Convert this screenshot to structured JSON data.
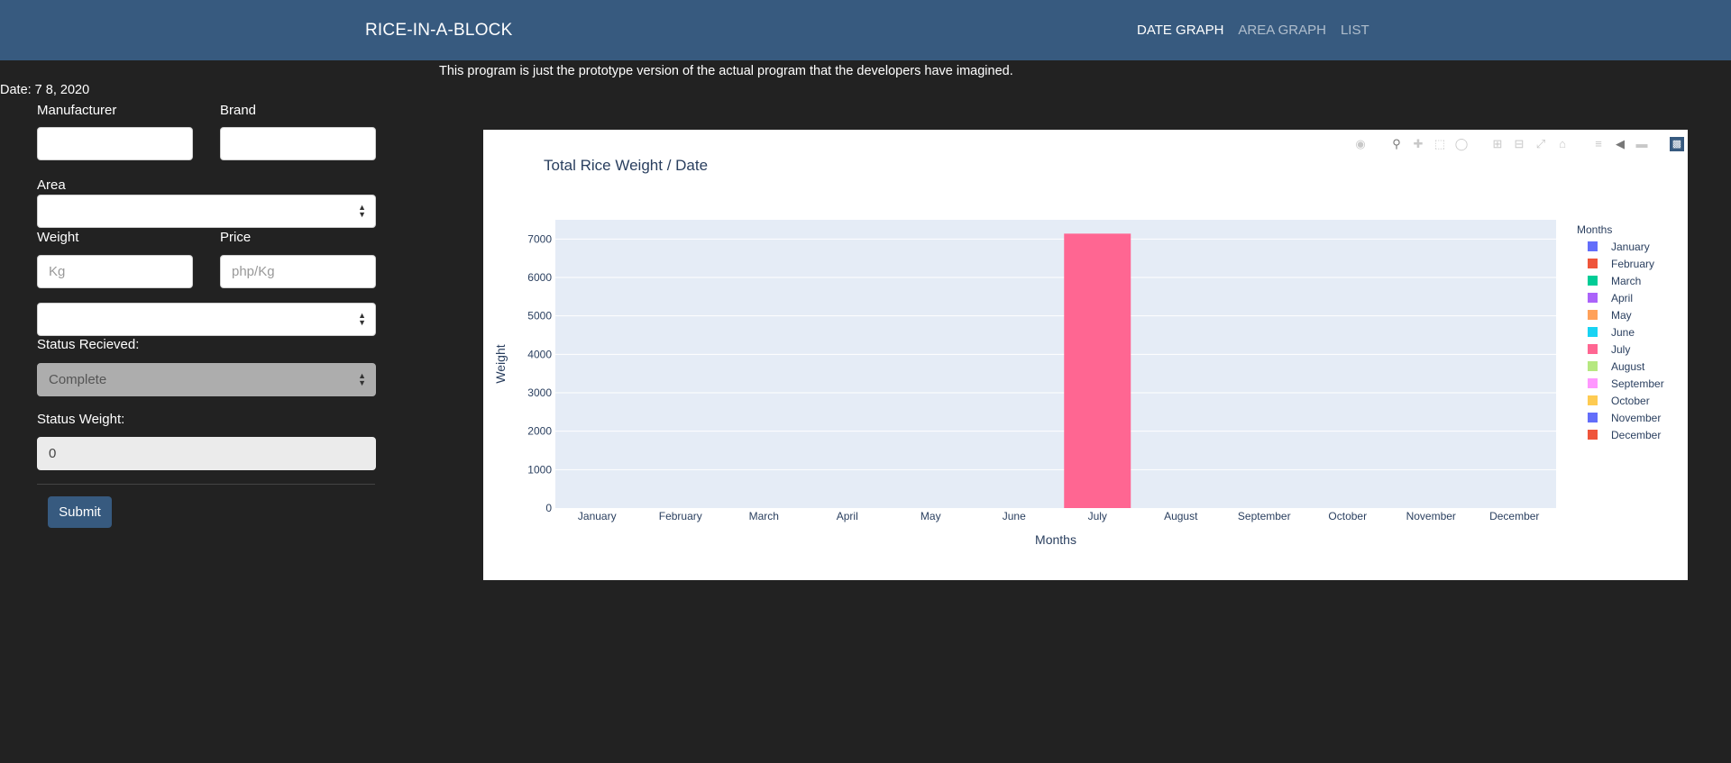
{
  "navbar": {
    "brand": "RICE-IN-A-BLOCK",
    "links": [
      {
        "label": "DATE GRAPH",
        "active": true
      },
      {
        "label": "AREA GRAPH",
        "active": false
      },
      {
        "label": "LIST",
        "active": false
      }
    ]
  },
  "notice": "This program is just the prototype version of the actual program that the developers have imagined.",
  "date_line": "Date: 7 8, 2020",
  "form": {
    "manufacturer_label": "Manufacturer",
    "manufacturer_value": "",
    "brand_label": "Brand",
    "brand_value": "",
    "area_label": "Area",
    "area_value": "",
    "weight_label": "Weight",
    "weight_placeholder": "Kg",
    "price_label": "Price",
    "price_placeholder": "php/Kg",
    "unlabeled_select_value": "",
    "status_received_label": "Status Recieved:",
    "status_received_value": "Complete",
    "status_weight_label": "Status Weight:",
    "status_weight_value": "0",
    "submit_label": "Submit"
  },
  "modebar_icons": [
    "camera-icon",
    "zoom-icon",
    "pan-icon",
    "box-select-icon",
    "lasso-select-icon",
    "zoom-in-icon",
    "zoom-out-icon",
    "autoscale-icon",
    "reset-axes-icon",
    "spike-lines-icon",
    "hover-closest-icon",
    "hover-compare-icon",
    "plotly-logo-icon"
  ],
  "chart_data": {
    "type": "bar",
    "title": "Total Rice Weight / Date",
    "xlabel": "Months",
    "ylabel": "Weight",
    "ylim": [
      0,
      7500
    ],
    "yticks": [
      0,
      1000,
      2000,
      3000,
      4000,
      5000,
      6000,
      7000
    ],
    "grid": true,
    "legend_title": "Months",
    "legend_position": "right",
    "categories": [
      "January",
      "February",
      "March",
      "April",
      "May",
      "June",
      "July",
      "August",
      "September",
      "October",
      "November",
      "December"
    ],
    "series": [
      {
        "name": "January",
        "color": "#636efa",
        "values": [
          0,
          0,
          0,
          0,
          0,
          0,
          0,
          0,
          0,
          0,
          0,
          0
        ]
      },
      {
        "name": "February",
        "color": "#ef553b",
        "values": [
          0,
          0,
          0,
          0,
          0,
          0,
          0,
          0,
          0,
          0,
          0,
          0
        ]
      },
      {
        "name": "March",
        "color": "#00cc96",
        "values": [
          0,
          0,
          0,
          0,
          0,
          0,
          0,
          0,
          0,
          0,
          0,
          0
        ]
      },
      {
        "name": "April",
        "color": "#ab63fa",
        "values": [
          0,
          0,
          0,
          0,
          0,
          0,
          0,
          0,
          0,
          0,
          0,
          0
        ]
      },
      {
        "name": "May",
        "color": "#ffa15a",
        "values": [
          0,
          0,
          0,
          0,
          0,
          0,
          0,
          0,
          0,
          0,
          0,
          0
        ]
      },
      {
        "name": "June",
        "color": "#19d3f3",
        "values": [
          0,
          0,
          0,
          0,
          0,
          0,
          0,
          0,
          0,
          0,
          0,
          0
        ]
      },
      {
        "name": "July",
        "color": "#ff6692",
        "values": [
          0,
          0,
          0,
          0,
          0,
          0,
          7140,
          0,
          0,
          0,
          0,
          0
        ]
      },
      {
        "name": "August",
        "color": "#b6e880",
        "values": [
          0,
          0,
          0,
          0,
          0,
          0,
          0,
          0,
          0,
          0,
          0,
          0
        ]
      },
      {
        "name": "September",
        "color": "#ff97ff",
        "values": [
          0,
          0,
          0,
          0,
          0,
          0,
          0,
          0,
          0,
          0,
          0,
          0
        ]
      },
      {
        "name": "October",
        "color": "#fecb52",
        "values": [
          0,
          0,
          0,
          0,
          0,
          0,
          0,
          0,
          0,
          0,
          0,
          0
        ]
      },
      {
        "name": "November",
        "color": "#636efa",
        "values": [
          0,
          0,
          0,
          0,
          0,
          0,
          0,
          0,
          0,
          0,
          0,
          0
        ]
      },
      {
        "name": "December",
        "color": "#ef553b",
        "values": [
          0,
          0,
          0,
          0,
          0,
          0,
          0,
          0,
          0,
          0,
          0,
          0
        ]
      }
    ],
    "month_totals": [
      0,
      0,
      0,
      0,
      0,
      0,
      7140,
      0,
      0,
      0,
      0,
      0
    ]
  }
}
